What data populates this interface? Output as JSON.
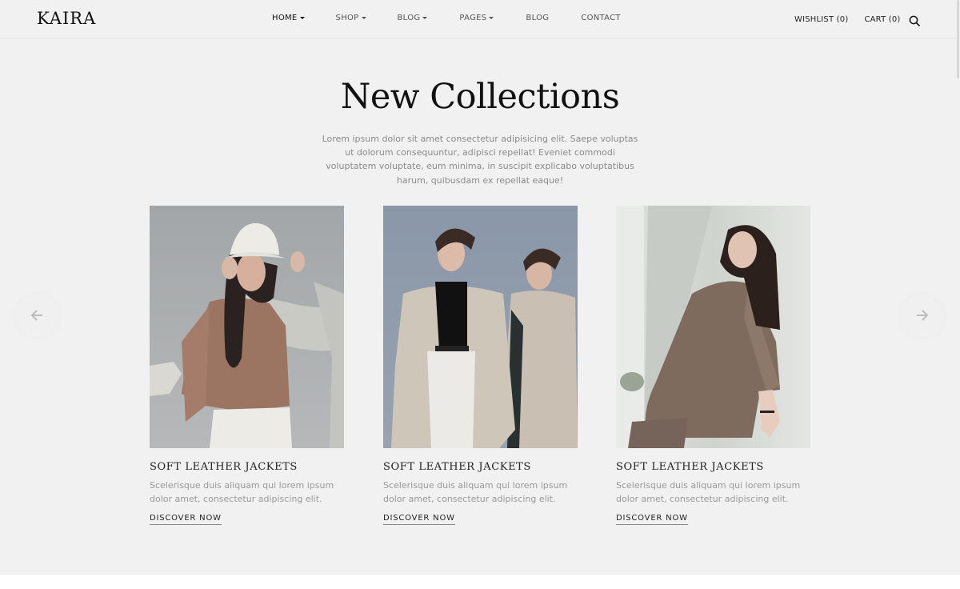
{
  "header": {
    "logo": "KAIRA",
    "nav": [
      {
        "label": "HOME",
        "dropdown": true,
        "active": true
      },
      {
        "label": "SHOP",
        "dropdown": true
      },
      {
        "label": "BLOG",
        "dropdown": true
      },
      {
        "label": "PAGES",
        "dropdown": true
      },
      {
        "label": "BLOG",
        "dropdown": false
      },
      {
        "label": "CONTACT",
        "dropdown": false
      }
    ],
    "wishlist": "WISHLIST (0)",
    "cart": "CART (0)",
    "search_icon": "search-icon"
  },
  "section": {
    "title": "New Collections",
    "intro": "Lorem ipsum dolor sit amet consectetur adipisicing elit. Saepe voluptas ut dolorum consequuntur, adipisci repellat! Eveniet commodi voluptatem voluptate, eum minima, in suscipit explicabo voluptatibus harum, quibusdam ex repellat eaque!"
  },
  "carousel": {
    "prev_icon": "arrow-left-icon",
    "next_icon": "arrow-right-icon",
    "items": [
      {
        "title": "SOFT LEATHER JACKETS",
        "description": "Scelerisque duis aliquam qui lorem ipsum dolor amet, consectetur adipiscing elit.",
        "link": "DISCOVER NOW",
        "image": "woman in white bucket hat and brown cropped top"
      },
      {
        "title": "SOFT LEATHER JACKETS",
        "description": "Scelerisque duis aliquam qui lorem ipsum dolor amet, consectetur adipiscing elit.",
        "link": "DISCOVER NOW",
        "image": "two women in beige trench coats"
      },
      {
        "title": "SOFT LEATHER JACKETS",
        "description": "Scelerisque duis aliquam qui lorem ipsum dolor amet, consectetur adipiscing elit.",
        "link": "DISCOVER NOW",
        "image": "woman in brown plaid blazer leaning on wall"
      }
    ]
  },
  "colors": {
    "background": "#f1f1f1",
    "text": "#111111",
    "muted": "#999999"
  }
}
